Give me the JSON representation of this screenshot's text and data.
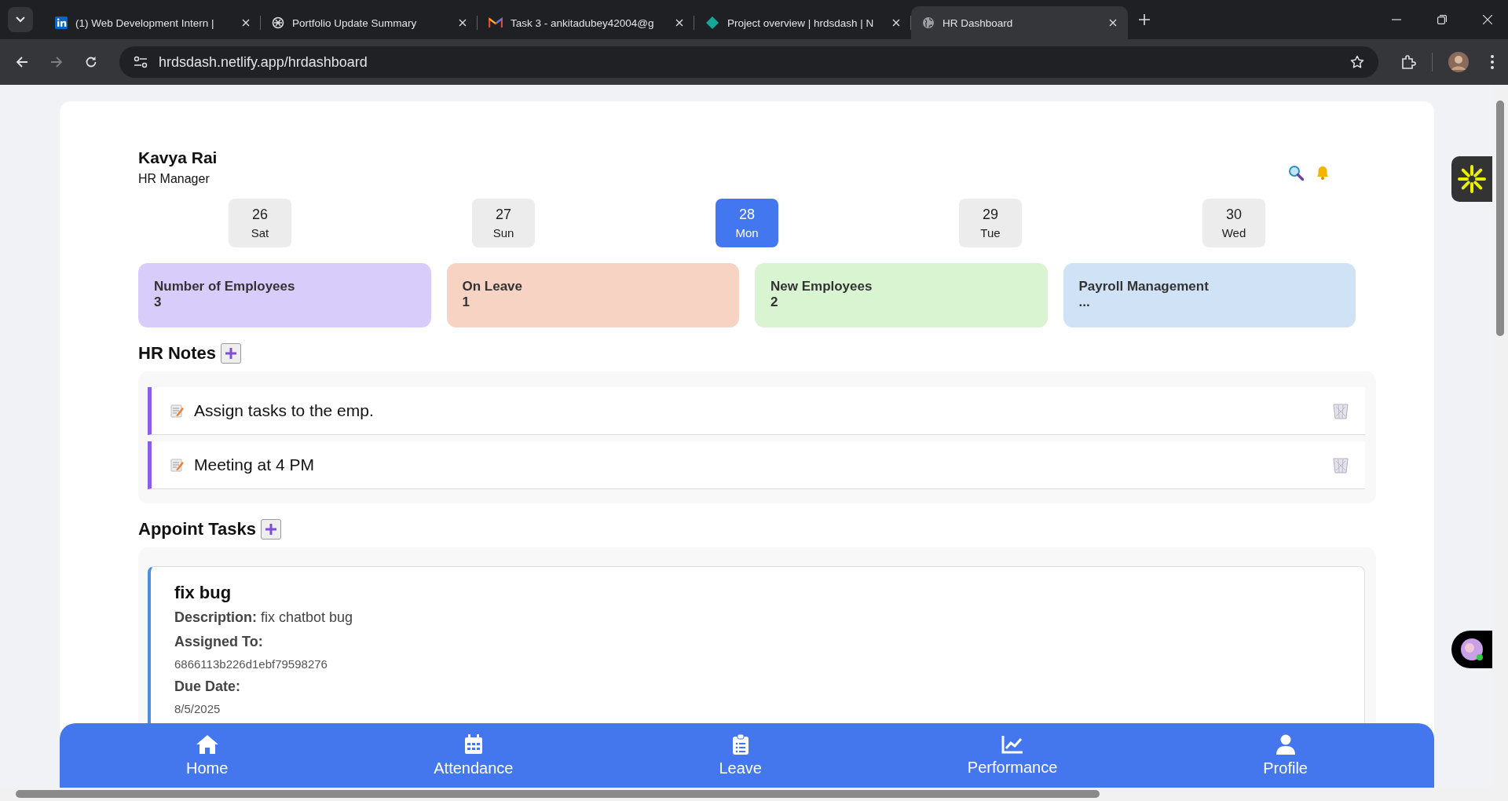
{
  "browser": {
    "tabs": [
      {
        "title": "(1) Web Development Intern |",
        "selected": false
      },
      {
        "title": "Portfolio Update Summary",
        "selected": false
      },
      {
        "title": "Task 3 - ankitadubey42004@g",
        "selected": false
      },
      {
        "title": "Project overview | hrdsdash | N",
        "selected": false
      },
      {
        "title": "HR Dashboard",
        "selected": true
      }
    ],
    "url": "hrdsdash.netlify.app/hrdashboard"
  },
  "user": {
    "name": "Kavya Rai",
    "role": "HR Manager"
  },
  "dates": [
    {
      "day": "26",
      "weekday": "Sat",
      "selected": false
    },
    {
      "day": "27",
      "weekday": "Sun",
      "selected": false
    },
    {
      "day": "28",
      "weekday": "Mon",
      "selected": true
    },
    {
      "day": "29",
      "weekday": "Tue",
      "selected": false
    },
    {
      "day": "30",
      "weekday": "Wed",
      "selected": false
    }
  ],
  "stats": [
    {
      "label": "Number of Employees",
      "value": "3",
      "color": "#d8ccfa"
    },
    {
      "label": "On Leave",
      "value": "1",
      "color": "#f6d3c3"
    },
    {
      "label": "New Employees",
      "value": "2",
      "color": "#d8f4d0"
    },
    {
      "label": "Payroll Management",
      "value": "...",
      "color": "#cfe2f6"
    }
  ],
  "notes_title": "HR Notes",
  "notes": [
    {
      "text": "Assign tasks to the emp."
    },
    {
      "text": "Meeting at 4 PM"
    }
  ],
  "tasks_title": "Appoint Tasks",
  "tasks": [
    {
      "title": "fix bug",
      "description_label": "Description:",
      "description": "fix chatbot bug",
      "assigned_label": "Assigned To:",
      "assigned": "6866113b226d1ebf79598276",
      "due_label": "Due Date:",
      "due": "8/5/2025"
    }
  ],
  "nav": [
    {
      "label": "Home"
    },
    {
      "label": "Attendance"
    },
    {
      "label": "Leave"
    },
    {
      "label": "Performance"
    },
    {
      "label": "Profile"
    }
  ]
}
